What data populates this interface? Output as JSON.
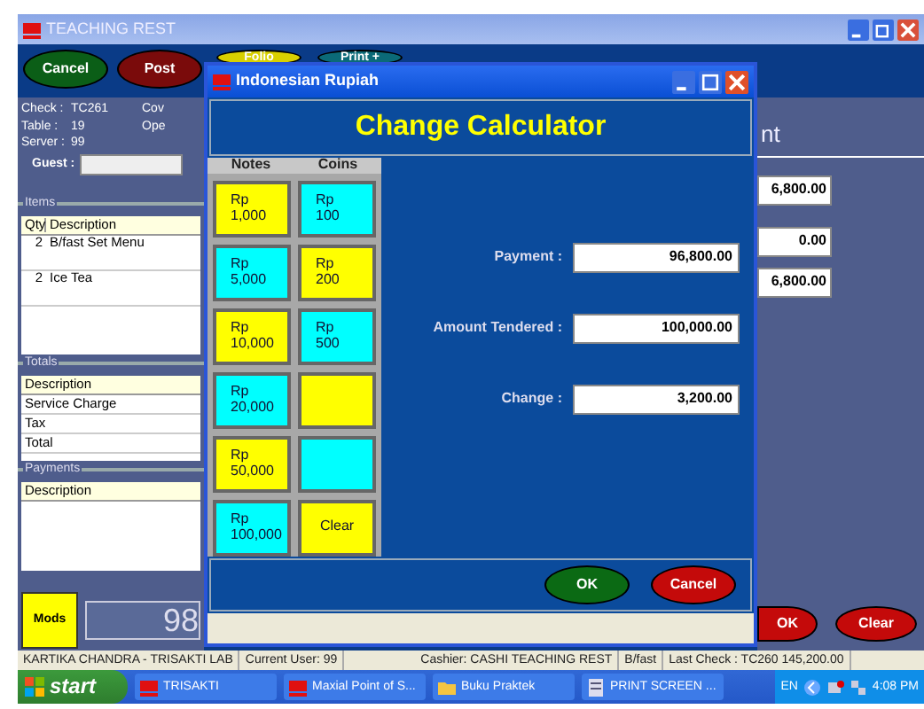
{
  "window": {
    "title": "TEACHING REST"
  },
  "toolbar": [
    {
      "label": "Cancel",
      "color": "#0b5e17"
    },
    {
      "label": "Post",
      "color": "#7a0b0b"
    },
    {
      "label": "Folio",
      "color": "#d8d000"
    },
    {
      "label": "Print +",
      "color": "#0b6a78"
    }
  ],
  "check_info": {
    "rows": [
      {
        "label": "Check :",
        "value": "TC261",
        "extra": "Cov"
      },
      {
        "label": "Table :",
        "value": "19",
        "extra": "Ope"
      },
      {
        "label": "Server :",
        "value": "99"
      }
    ],
    "guest_label": "Guest :"
  },
  "items": {
    "title": "Items",
    "columns": [
      "Qty",
      "Description"
    ],
    "rows": [
      {
        "qty": "2",
        "description": "B/fast Set Menu"
      },
      {
        "qty": "2",
        "description": "Ice Tea"
      }
    ]
  },
  "totals": {
    "title": "Totals",
    "header": "Description",
    "rows": [
      "Service Charge",
      "Tax",
      "Total"
    ]
  },
  "payments": {
    "title": "Payments",
    "header": "Description"
  },
  "mods_button": "Mods",
  "display": "98",
  "right_panel": {
    "title": "nt",
    "values": [
      "6,800.00",
      "0.00",
      "6,800.00"
    ],
    "buttons": [
      "OK",
      "Clear"
    ]
  },
  "status_bar": [
    "KARTIKA CHANDRA - TRISAKTI LAB",
    "Current User: 99",
    "Cashier: CASHI TEACHING REST",
    "B/fast",
    "Last Check : TC260  145,200.00"
  ],
  "taskbar": {
    "start": "start",
    "tasks": [
      {
        "label": "TRISAKTI",
        "kind": "app"
      },
      {
        "label": "Maxial Point of S...",
        "kind": "app"
      },
      {
        "label": "Buku Praktek",
        "kind": "folder"
      },
      {
        "label": "PRINT SCREEN ...",
        "kind": "doc"
      }
    ],
    "language": "EN",
    "clock": "4:08 PM"
  },
  "dialog": {
    "title": "Indonesian Rupiah",
    "heading": "Change Calculator",
    "columns": [
      "Notes",
      "Coins"
    ],
    "keys": [
      {
        "label": "Rp\n1,000",
        "color": "#ffff00"
      },
      {
        "label": "Rp\n100",
        "color": "#00ffff"
      },
      {
        "label": "Rp\n5,000",
        "color": "#00ffff"
      },
      {
        "label": "Rp\n200",
        "color": "#ffff00"
      },
      {
        "label": "Rp\n10,000",
        "color": "#ffff00"
      },
      {
        "label": "Rp\n500",
        "color": "#00ffff"
      },
      {
        "label": "Rp\n20,000",
        "color": "#00ffff"
      },
      {
        "color": "#ffff00"
      },
      {
        "label": "Rp\n50,000",
        "color": "#ffff00"
      },
      {
        "color": "#00ffff"
      },
      {
        "label": "Rp\n100,000",
        "color": "#00ffff"
      },
      {
        "label": "Clear",
        "color": "#ffff00"
      }
    ],
    "fields": [
      {
        "label": "Payment :",
        "value": "96,800.00"
      },
      {
        "label": "Amount Tendered :",
        "value": "100,000.00"
      },
      {
        "label": "Change :",
        "value": "3,200.00"
      }
    ],
    "buttons": [
      {
        "label": "OK",
        "color": "#0b6a14"
      },
      {
        "label": "Cancel",
        "color": "#c40a0a"
      }
    ]
  }
}
